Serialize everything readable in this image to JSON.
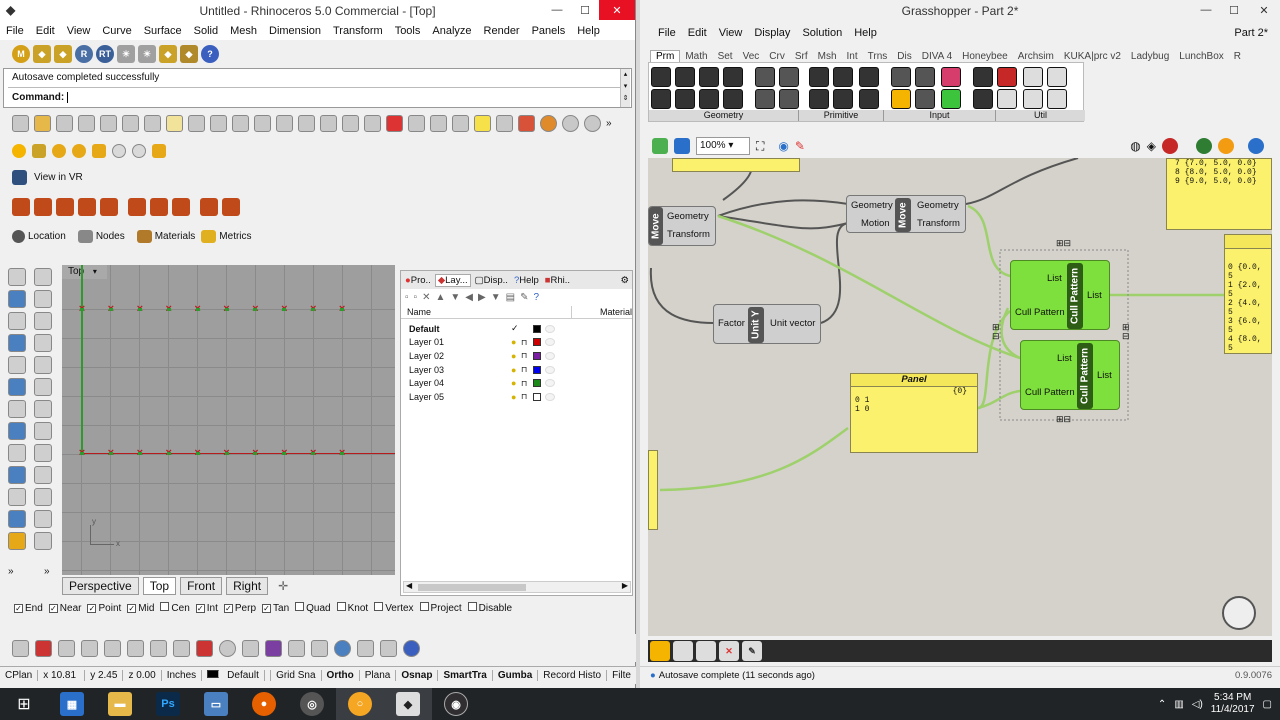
{
  "rhino": {
    "title": "Untitled - Rhinoceros 5.0 Commercial - [Top]",
    "menu": [
      "File",
      "Edit",
      "View",
      "Curve",
      "Surface",
      "Solid",
      "Mesh",
      "Dimension",
      "Transform",
      "Tools",
      "Analyze",
      "Render",
      "Panels",
      "Help"
    ],
    "history": "Autosave completed successfully",
    "command_label": "Command:",
    "vr_label": "View in VR",
    "toolbar_buttons": {
      "location": "Location",
      "nodes": "Nodes",
      "materials": "Materials",
      "metrics": "Metrics"
    },
    "viewport_label": "Top",
    "axis_y": "y",
    "axis_x": "x",
    "view_tabs": [
      "Perspective",
      "Top",
      "Front",
      "Right"
    ],
    "active_view_tab": "Top",
    "panel_tabs": [
      "Pro..",
      "Lay...",
      "Disp..",
      "Help",
      "Rhi.."
    ],
    "layers_header": {
      "name": "Name",
      "material": "Material"
    },
    "layers": [
      {
        "name": "Default",
        "color": "#000000",
        "current": true
      },
      {
        "name": "Layer 01",
        "color": "#cc0000",
        "current": false
      },
      {
        "name": "Layer 02",
        "color": "#7b1fa2",
        "current": false
      },
      {
        "name": "Layer 03",
        "color": "#0000ee",
        "current": false
      },
      {
        "name": "Layer 04",
        "color": "#1b8a1b",
        "current": false
      },
      {
        "name": "Layer 05",
        "color": "#ffffff",
        "current": false
      }
    ],
    "current_mark": "✓",
    "osnaps": [
      {
        "label": "End",
        "checked": true
      },
      {
        "label": "Near",
        "checked": true
      },
      {
        "label": "Point",
        "checked": true
      },
      {
        "label": "Mid",
        "checked": true
      },
      {
        "label": "Cen",
        "checked": false
      },
      {
        "label": "Int",
        "checked": true
      },
      {
        "label": "Perp",
        "checked": true
      },
      {
        "label": "Tan",
        "checked": true
      },
      {
        "label": "Quad",
        "checked": false
      },
      {
        "label": "Knot",
        "checked": false
      },
      {
        "label": "Vertex",
        "checked": false
      },
      {
        "label": "Project",
        "checked": false
      },
      {
        "label": "Disable",
        "checked": false
      }
    ],
    "status": {
      "cplane": "CPlan",
      "x": "x 10.81",
      "y": "y 2.45",
      "z": "z 0.00",
      "units": "Inches",
      "layer": "Default",
      "toggles": [
        "Grid Sna",
        "Ortho",
        "Plana",
        "Osnap",
        "SmartTra",
        "Gumba",
        "Record Histo",
        "Filte"
      ]
    }
  },
  "gh": {
    "title": "Grasshopper - Part 2*",
    "menu": [
      "File",
      "Edit",
      "View",
      "Display",
      "Solution",
      "Help"
    ],
    "doc_name": "Part 2*",
    "tabs": [
      "Prm",
      "Math",
      "Set",
      "Vec",
      "Crv",
      "Srf",
      "Msh",
      "Int",
      "Trns",
      "Dis",
      "DIVA 4",
      "Honeybee",
      "Archsim",
      "KUKA|prc v2",
      "Ladybug",
      "LunchBox",
      "R"
    ],
    "active_tab": "Prm",
    "groups": [
      "Geometry",
      "Primitive",
      "Input",
      "Util"
    ],
    "zoom": "100%",
    "components": {
      "move_left": {
        "in1": "Geometry",
        "in2": "Transform",
        "name": "Move"
      },
      "move_main": {
        "in1": "Geometry",
        "in2": "Motion",
        "out1": "Geometry",
        "out2": "Transform",
        "name": "Move"
      },
      "unit_y": {
        "in": "Factor",
        "out": "Unit vector",
        "name": "Unit Y"
      },
      "cull1": {
        "in1": "List",
        "in2": "Cull Pattern",
        "out": "List",
        "name": "Cull Pattern"
      },
      "cull2": {
        "in1": "List",
        "in2": "Cull Pattern",
        "out": "List",
        "name": "Cull Pattern"
      }
    },
    "panel": {
      "title": "Panel",
      "path": "{0}",
      "rows": [
        "0 1",
        "1 0"
      ]
    },
    "panel_topright": [
      "7 {7.0, 5.0, 0.0}",
      "8 {8.0, 5.0, 0.0}",
      "9 {9.0, 5.0, 0.0}"
    ],
    "panel_right": [
      "0 {0.0, 5",
      "1 {2.0, 5",
      "2 {4.0, 5",
      "3 {6.0, 5",
      "4 {8.0, 5"
    ],
    "status": "Autosave complete (11 seconds ago)",
    "version": "0.9.0076"
  },
  "taskbar": {
    "time": "5:34 PM",
    "date": "11/4/2017"
  },
  "colors": {
    "rhino_red": "#b71c1c",
    "green_marker": "#2e9a2e",
    "gh_green": "#7ee03c",
    "gh_yellow": "#fbf16c",
    "close_red": "#e81123"
  }
}
